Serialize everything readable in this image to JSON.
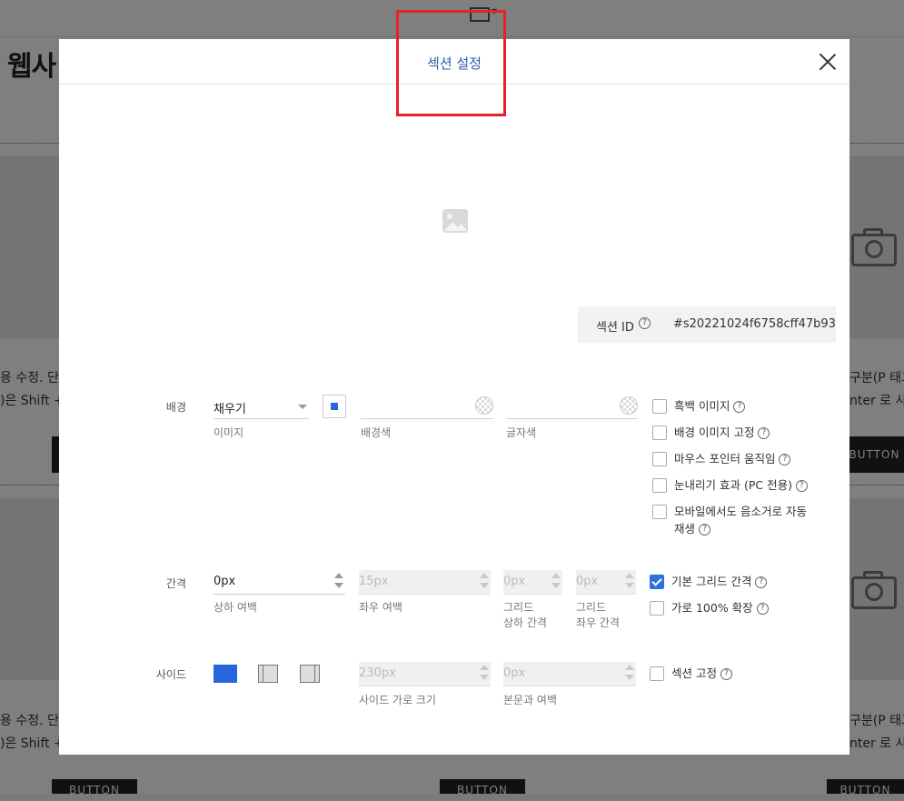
{
  "background_page": {
    "title": "웹사",
    "text_left_1": "용 수정. 단",
    "text_left_2": ")은 Shift +",
    "text_right_1": "구분(P 태그",
    "text_right_2": "nter 로 사용",
    "button_right": "BUTTON",
    "button_bottom": "BUTTON"
  },
  "modal": {
    "title": "섹션 설정",
    "section_id": {
      "label": "섹션 ID",
      "value": "#s20221024f6758cff47b93"
    },
    "background_row": {
      "label": "배경",
      "fill_select": {
        "value": "채우기",
        "caption": "이미지"
      },
      "bg_color_caption": "배경색",
      "text_color_caption": "글자색",
      "options": [
        {
          "label": "흑백 이미지",
          "checked": false
        },
        {
          "label": "배경 이미지 고정",
          "checked": false
        },
        {
          "label": "마우스 포인터 움직임",
          "checked": false
        },
        {
          "label": "눈내리기 효과 (PC 전용)",
          "checked": false
        },
        {
          "label": "모바일에서도 음소거로 자동",
          "label2": "재생",
          "checked": false
        }
      ]
    },
    "spacing_row": {
      "label": "간격",
      "vertical_padding": {
        "value": "0px",
        "caption": "상하 여백"
      },
      "horizontal_padding": {
        "value": "15px",
        "caption": "좌우 여백"
      },
      "grid_vertical": {
        "value": "0px",
        "caption1": "그리드",
        "caption2": "상하 간격"
      },
      "grid_horizontal": {
        "value": "0px",
        "caption1": "그리드",
        "caption2": "좌우 간격"
      },
      "options": [
        {
          "label": "기본 그리드 간격",
          "checked": true
        },
        {
          "label": "가로 100% 확장",
          "checked": false
        }
      ]
    },
    "side_row": {
      "label": "사이드",
      "side_width": {
        "value": "230px",
        "caption": "사이드 가로 크기"
      },
      "body_margin": {
        "value": "0px",
        "caption": "본문과 여백"
      },
      "options": [
        {
          "label": "섹션 고정",
          "checked": false
        }
      ]
    }
  },
  "colors": {
    "accent": "#2866e0",
    "title": "#2a5ca8",
    "highlight": "#e5222b"
  }
}
